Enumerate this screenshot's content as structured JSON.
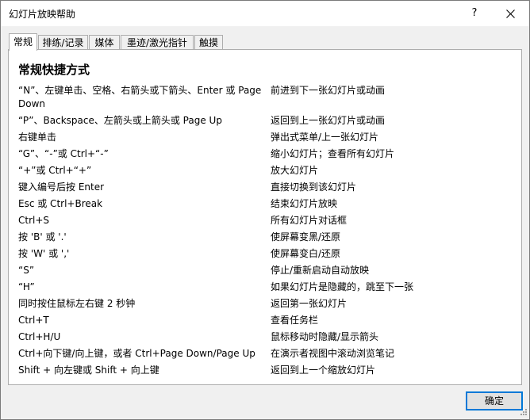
{
  "window": {
    "title": "幻灯片放映帮助",
    "help_label": "?"
  },
  "tabs": [
    {
      "label": "常规"
    },
    {
      "label": "排练/记录"
    },
    {
      "label": "媒体"
    },
    {
      "label": "墨迹/激光指针"
    },
    {
      "label": "触摸"
    }
  ],
  "panel": {
    "heading": "常规快捷方式",
    "shortcuts": [
      {
        "key": "“N”、左键单击、空格、右箭头或下箭头、Enter 或 Page Down",
        "desc": "前进到下一张幻灯片或动画"
      },
      {
        "key": "“P”、Backspace、左箭头或上箭头或 Page Up",
        "desc": "返回到上一张幻灯片或动画"
      },
      {
        "key": "右键单击",
        "desc": "弹出式菜单/上一张幻灯片"
      },
      {
        "key": "“G”、“-”或 Ctrl+“-”",
        "desc": "缩小幻灯片；查看所有幻灯片"
      },
      {
        "key": "“+”或 Ctrl+“+”",
        "desc": "放大幻灯片"
      },
      {
        "key": "键入编号后按 Enter",
        "desc": "直接切换到该幻灯片"
      },
      {
        "key": "Esc 或 Ctrl+Break",
        "desc": "结束幻灯片放映"
      },
      {
        "key": "Ctrl+S",
        "desc": "所有幻灯片对话框"
      },
      {
        "key": "按 'B' 或 '.'",
        "desc": "使屏幕变黑/还原"
      },
      {
        "key": "按 'W' 或 ','",
        "desc": "使屏幕变白/还原"
      },
      {
        "key": "“S”",
        "desc": "停止/重新启动自动放映"
      },
      {
        "key": "“H”",
        "desc": "如果幻灯片是隐藏的，跳至下一张"
      },
      {
        "key": "同时按住鼠标左右键 2 秒钟",
        "desc": "返回第一张幻灯片"
      },
      {
        "key": "Ctrl+T",
        "desc": "查看任务栏"
      },
      {
        "key": "Ctrl+H/U",
        "desc": "鼠标移动时隐藏/显示箭头"
      },
      {
        "key": "Ctrl+向下键/向上键，或者 Ctrl+Page Down/Page Up",
        "desc": "在演示者视图中滚动浏览笔记"
      },
      {
        "key": "Shift + 向左键或 Shift + 向上键",
        "desc": "返回到上一个缩放幻灯片"
      }
    ]
  },
  "footer": {
    "ok_label": "确定"
  }
}
